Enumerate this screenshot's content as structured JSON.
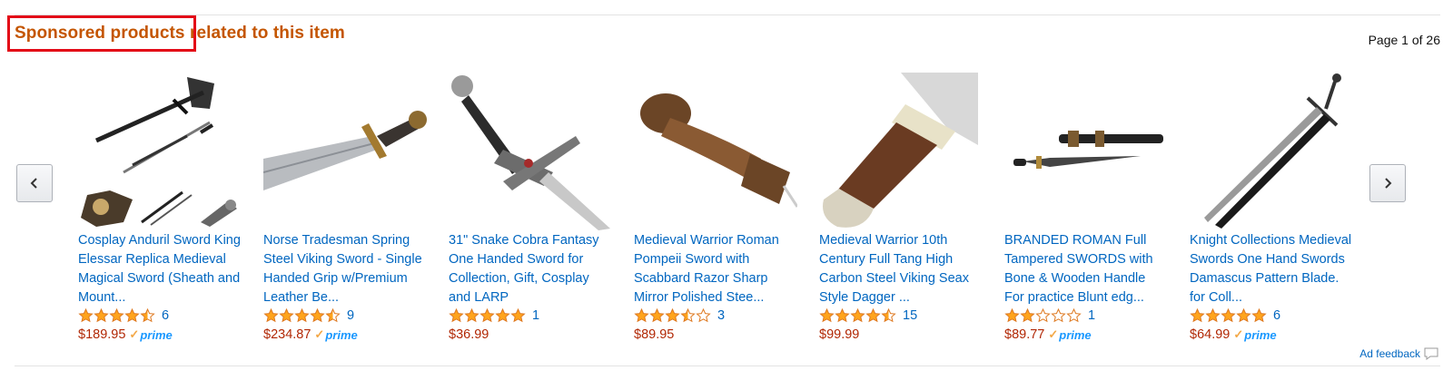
{
  "header": {
    "title": "Sponsored products related to this item",
    "page_indicator": "Page 1 of 26"
  },
  "navigation": {
    "prev_icon": "chevron-left-icon",
    "next_icon": "chevron-right-icon"
  },
  "products": [
    {
      "name": "Cosplay Anduril Sword King Elessar Replica Medieval Magical Sword (Sheath and Mount...",
      "rating": 4.5,
      "review_count": "6",
      "price": "$189.95",
      "prime": true
    },
    {
      "name": "Norse Tradesman Spring Steel Viking Sword - Single Handed Grip w/Premium Leather Be...",
      "rating": 4.5,
      "review_count": "9",
      "price": "$234.87",
      "prime": true
    },
    {
      "name": "31\" Snake Cobra Fantasy One Handed Sword for Collection, Gift, Cosplay and LARP",
      "rating": 5,
      "review_count": "1",
      "price": "$36.99",
      "prime": false
    },
    {
      "name": "Medieval Warrior Roman Pompeii Sword with Scabbard Razor Sharp Mirror Polished Stee...",
      "rating": 3.5,
      "review_count": "3",
      "price": "$89.95",
      "prime": false
    },
    {
      "name": "Medieval Warrior 10th Century Full Tang High Carbon Steel Viking Seax Style Dagger ...",
      "rating": 4.5,
      "review_count": "15",
      "price": "$99.99",
      "prime": false
    },
    {
      "name": "BRANDED ROMAN Full Tampered SWORDS with Bone & Wooden Handle For practice Blunt edg...",
      "rating": 2,
      "review_count": "1",
      "price": "$89.77",
      "prime": true
    },
    {
      "name": "Knight Collections Medieval Swords One Hand Swords Damascus Pattern Blade. for Coll...",
      "rating": 5,
      "review_count": "6",
      "price": "$64.99",
      "prime": true
    }
  ],
  "prime_label": "prime",
  "ad_feedback": "Ad feedback",
  "colors": {
    "title": "#c45500",
    "link": "#0066c0",
    "price": "#b12704",
    "star": "#ffa41c",
    "prime": "#1a98ff",
    "highlight": "#e30a17"
  }
}
